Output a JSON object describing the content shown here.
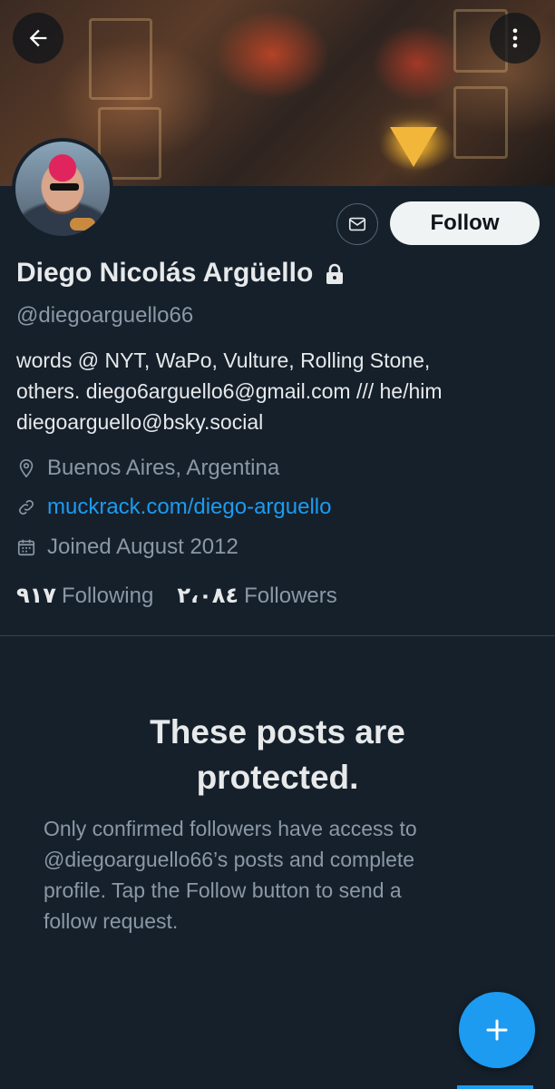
{
  "header": {
    "back_icon": "arrow-left-icon",
    "more_icon": "more-vertical-icon"
  },
  "profile": {
    "name": "Diego Nicolás Argüello",
    "handle": "@diegoarguello66",
    "protected_icon": "lock-icon",
    "bio": [
      "words @ NYT, WaPo, Vulture, Rolling Stone,",
      "others. diego6arguello6@gmail.com /// he/him",
      "diegoarguello@bsky.social"
    ],
    "location": "Buenos Aires, Argentina",
    "website": "muckrack.com/diego-arguello",
    "joined": "Joined August 2012",
    "following_count": "٩١٧",
    "following_label": "Following",
    "followers_count": "٢،٠٨٤",
    "followers_label": "Followers"
  },
  "actions": {
    "message_icon": "envelope-icon",
    "follow_label": "Follow"
  },
  "protected_notice": {
    "title_line1": "These posts are",
    "title_line2": "protected.",
    "body_lines": [
      "Only confirmed followers have access to",
      "@diegoarguello66’s posts and complete",
      "profile. Tap the Follow button to send a",
      "follow request."
    ]
  },
  "fab": {
    "icon": "plus-icon"
  },
  "colors": {
    "background": "#15202b",
    "accent": "#1d9bf0",
    "muted_text": "#8b98a5",
    "primary_text": "#e7e9ea"
  }
}
